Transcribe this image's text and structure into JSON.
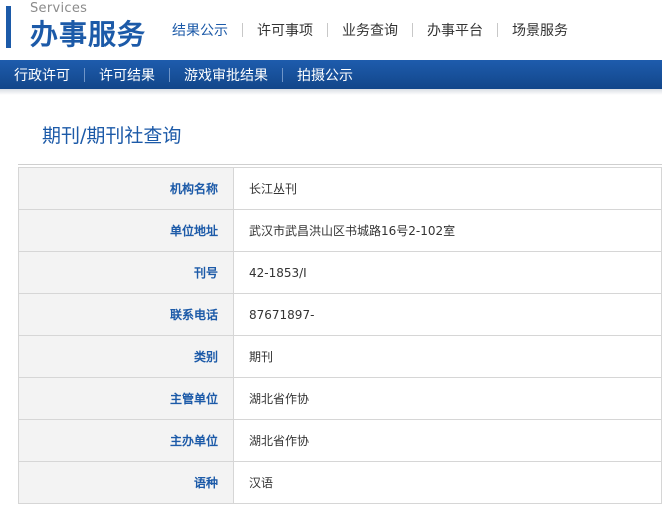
{
  "header": {
    "logo_en": "Services",
    "logo_cn": "办事服务",
    "nav": [
      "结果公示",
      "许可事项",
      "业务查询",
      "办事平台",
      "场景服务"
    ]
  },
  "subnav": [
    "行政许可",
    "许可结果",
    "游戏审批结果",
    "拍摄公示"
  ],
  "page": {
    "title": "期刊/期刊社查询"
  },
  "details": [
    {
      "label": "机构名称",
      "value": "长江丛刊"
    },
    {
      "label": "单位地址",
      "value": "武汉市武昌洪山区书城路16号2-102室"
    },
    {
      "label": "刊号",
      "value": "42-1853/I"
    },
    {
      "label": "联系电话",
      "value": "87671897-"
    },
    {
      "label": "类别",
      "value": "期刊"
    },
    {
      "label": "主管单位",
      "value": "湖北省作协"
    },
    {
      "label": "主办单位",
      "value": "湖北省作协"
    },
    {
      "label": "语种",
      "value": "汉语"
    }
  ],
  "colors": {
    "brand": "#1c5aa8",
    "label_bg": "#f3f3f3",
    "border": "#d6d6d6"
  }
}
